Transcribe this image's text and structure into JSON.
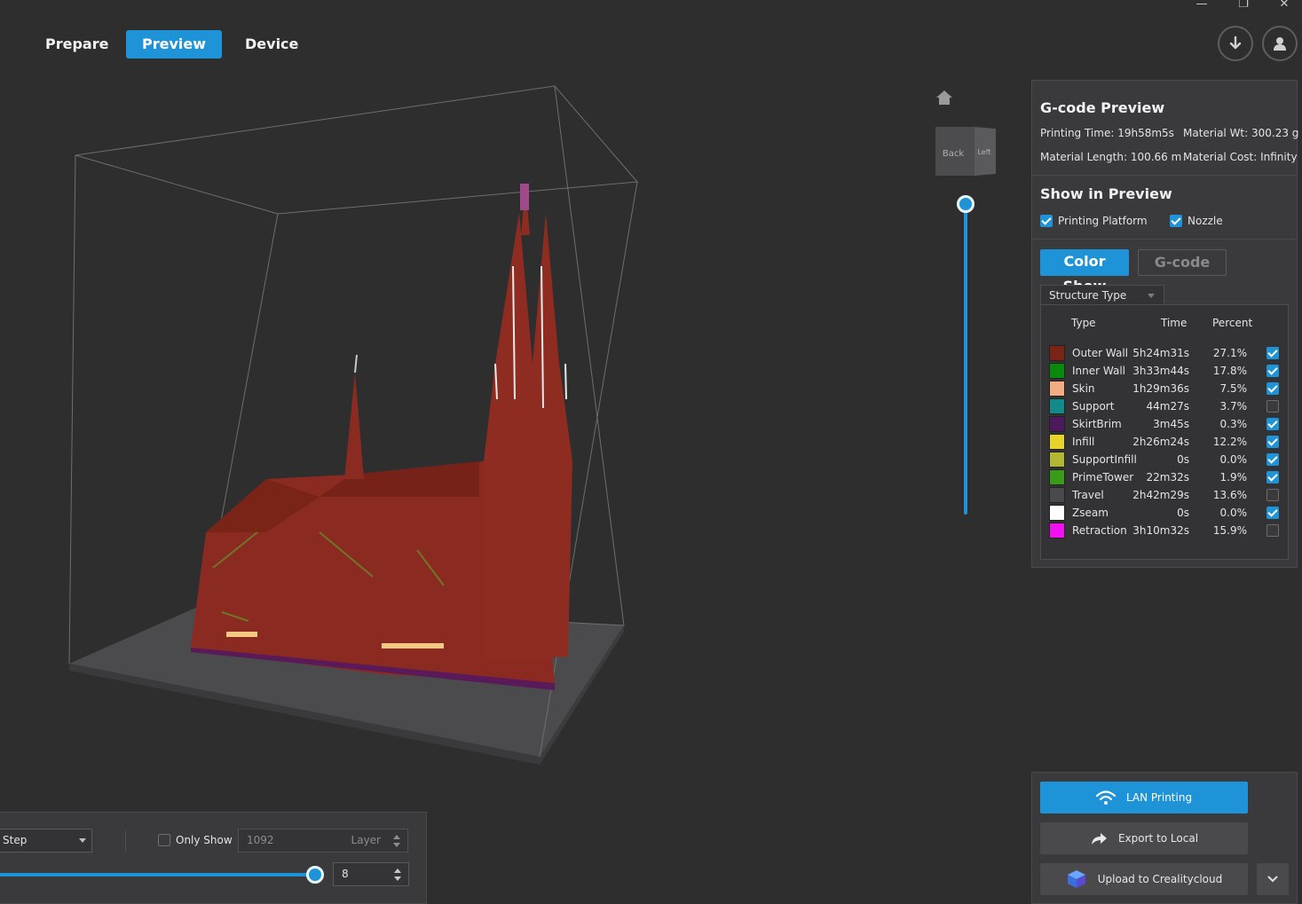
{
  "nav": {
    "tabs": [
      {
        "label": "Prepare",
        "active": false
      },
      {
        "label": "Preview",
        "active": true
      },
      {
        "label": "Device",
        "active": false
      }
    ]
  },
  "window_controls": {
    "minimize": "—",
    "restore": "❐",
    "close": "✕"
  },
  "icons": {
    "download": "download-icon",
    "account": "user-icon",
    "home": "home-icon"
  },
  "viewcube": {
    "face_front": "Back",
    "face_side": "Left"
  },
  "gcode_preview": {
    "title": "G-code Preview",
    "printing_time": "Printing Time: 19h58m5s",
    "material_wt": "Material Wt: 300.23 g",
    "material_length": "Material Length: 100.66 m",
    "material_cost": "Material Cost: Infinity"
  },
  "show_in_preview": {
    "title": "Show in Preview",
    "printing_platform": "Printing Platform",
    "printing_platform_checked": true,
    "nozzle": "Nozzle",
    "nozzle_checked": true
  },
  "mode": {
    "color_show": "Color Show",
    "gcode": "G-code"
  },
  "legend": {
    "selector": "Structure Type",
    "headers": {
      "type": "Type",
      "time": "Time",
      "percent": "Percent"
    },
    "rows": [
      {
        "type": "Outer Wall",
        "time": "5h24m31s",
        "percent": "27.1%",
        "color": "#7a2418",
        "checked": true
      },
      {
        "type": "Inner Wall",
        "time": "3h33m44s",
        "percent": "17.8%",
        "color": "#0a8a0a",
        "checked": true
      },
      {
        "type": "Skin",
        "time": "1h29m36s",
        "percent": "7.5%",
        "color": "#f4ad82",
        "checked": true
      },
      {
        "type": "Support",
        "time": "44m27s",
        "percent": "3.7%",
        "color": "#128a8a",
        "checked": false
      },
      {
        "type": "SkirtBrim",
        "time": "3m45s",
        "percent": "0.3%",
        "color": "#4a1a5a",
        "checked": true
      },
      {
        "type": "Infill",
        "time": "2h26m24s",
        "percent": "12.2%",
        "color": "#e6d42a",
        "checked": true
      },
      {
        "type": "SupportInfill",
        "time": "0s",
        "percent": "0.0%",
        "color": "#b3b833",
        "checked": true
      },
      {
        "type": "PrimeTower",
        "time": "22m32s",
        "percent": "1.9%",
        "color": "#3a9a1a",
        "checked": true
      },
      {
        "type": "Travel",
        "time": "2h42m29s",
        "percent": "13.6%",
        "color": "#4a4a4c",
        "checked": false
      },
      {
        "type": "Zseam",
        "time": "0s",
        "percent": "0.0%",
        "color": "#ffffff",
        "checked": true
      },
      {
        "type": "Retraction",
        "time": "3h10m32s",
        "percent": "15.9%",
        "color": "#f010f0",
        "checked": false
      }
    ]
  },
  "actions": {
    "lan_printing": "LAN Printing",
    "export_local": "Export to Local",
    "upload_cloud": "Upload to Crealitycloud"
  },
  "layer_control": {
    "mode": "Step",
    "only_show": "Only Show",
    "only_show_checked": false,
    "layer_value": "1092",
    "layer_unit": "Layer",
    "step_value": "8",
    "step_progress": 1.0
  },
  "colors": {
    "accent": "#1f93d8",
    "model": "#8b2a20",
    "bed": "#4a4a4c"
  }
}
